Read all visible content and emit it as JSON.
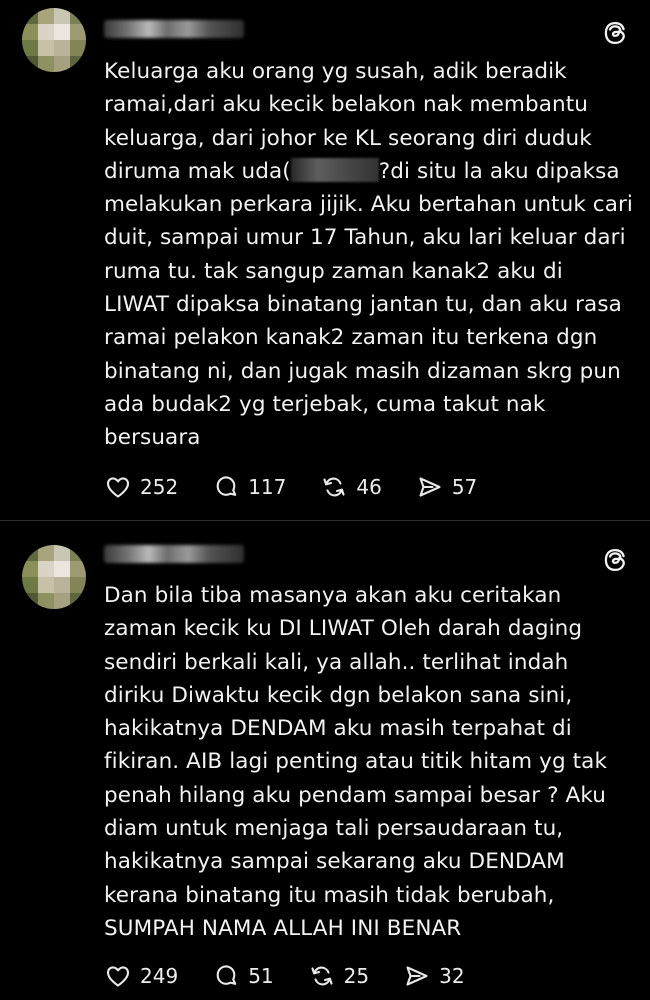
{
  "colors": {
    "background": "#000000",
    "text": "#f2f2f2",
    "divider": "#2c2c2c"
  },
  "posts": [
    {
      "text_before_redaction": "Keluarga aku orang yg susah, adik beradik ramai,dari aku kecik belakon nak membantu keluarga, dari johor ke KL seorang diri duduk diruma mak uda(",
      "text_after_redaction": "?di situ la aku dipaksa melakukan perkara jijik. Aku bertahan untuk cari duit, sampai umur 17 Tahun, aku lari keluar dari ruma tu. tak sangup zaman kanak2 aku di LIWAT dipaksa binatang jantan tu, dan aku rasa ramai pelakon kanak2 zaman itu terkena dgn binatang ni, dan jugak masih dizaman skrg pun ada budak2 yg terjebak, cuma takut nak bersuara",
      "likes": "252",
      "replies": "117",
      "reposts": "46",
      "shares": "57"
    },
    {
      "text": "Dan bila tiba masanya akan aku ceritakan zaman kecik ku DI LIWAT Oleh darah daging sendiri berkali kali, ya allah.. terlihat indah diriku Diwaktu kecik dgn belakon sana sini, hakikatnya DENDAM aku masih terpahat di fikiran. AIB lagi penting atau titik hitam yg tak penah hilang aku pendam sampai besar ? Aku diam untuk menjaga tali persaudaraan tu, hakikatnya sampai sekarang aku DENDAM kerana binatang itu masih tidak berubah, SUMPAH NAMA ALLAH INI BENAR",
      "likes": "249",
      "replies": "51",
      "reposts": "25",
      "shares": "32"
    }
  ]
}
